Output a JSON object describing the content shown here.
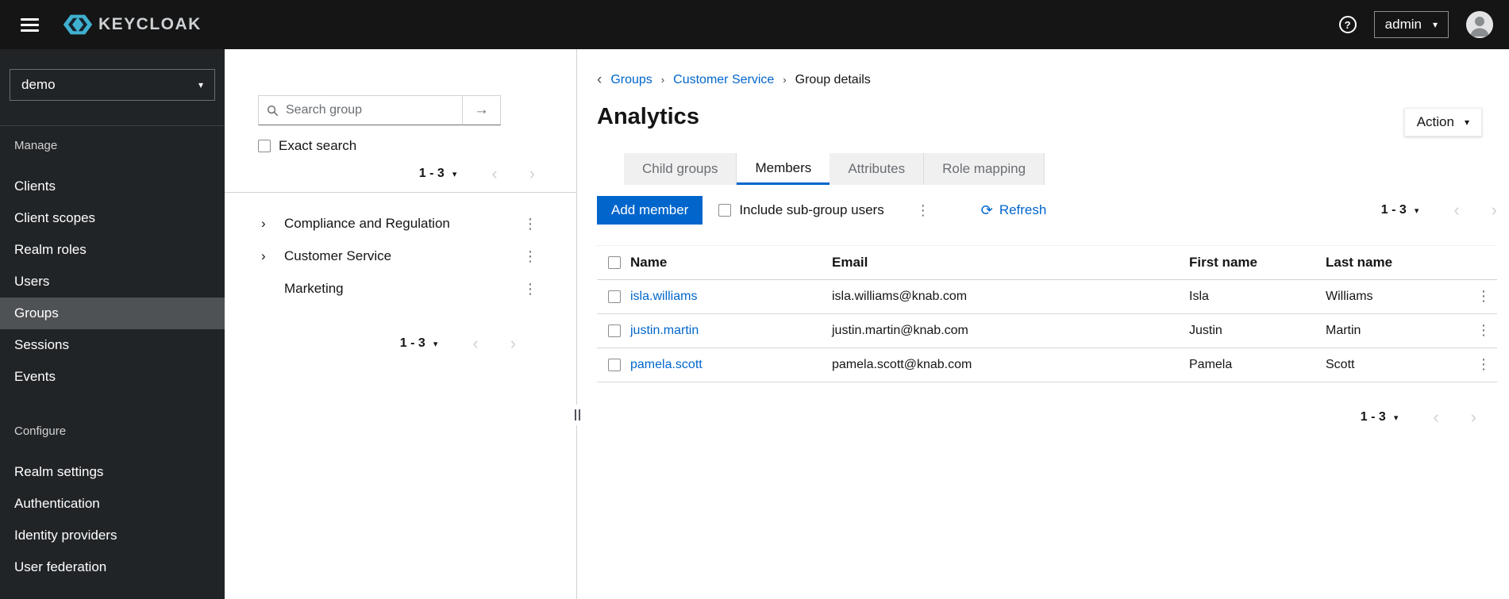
{
  "colors": {
    "accent": "#0066cc",
    "link": "#0066cc",
    "masthead_bg": "#151515",
    "sidebar_bg": "#212427",
    "nav_active_bg": "#4f5255",
    "tab_inactive_bg": "#f0f0f0"
  },
  "icons": {
    "hamburger": "menu-bars",
    "help": "?",
    "caret_down": "▾",
    "chevron_left": "‹",
    "chevron_right": "›",
    "tree_expand": "›",
    "kebab": "⋮",
    "search": "magnifier",
    "search_submit": "→",
    "refresh": "⟳",
    "breadcrumb_back": "‹",
    "breadcrumb_sep": "›"
  },
  "masthead": {
    "brand": "KEYCLOAK",
    "username": "admin"
  },
  "sidebar": {
    "realm": "demo",
    "active_item": "Groups",
    "manage": {
      "label": "Manage",
      "items": [
        "Clients",
        "Client scopes",
        "Realm roles",
        "Users",
        "Groups",
        "Sessions",
        "Events"
      ]
    },
    "configure": {
      "label": "Configure",
      "items": [
        "Realm settings",
        "Authentication",
        "Identity providers",
        "User federation"
      ]
    }
  },
  "tree": {
    "search_placeholder": "Search group",
    "exact_search_label": "Exact search",
    "pagination_top": "1 - 3",
    "pagination_bottom": "1 - 3",
    "items": [
      {
        "label": "Compliance and Regulation",
        "expandable": true
      },
      {
        "label": "Customer Service",
        "expandable": true
      },
      {
        "label": "Marketing",
        "expandable": false
      }
    ]
  },
  "main": {
    "breadcrumb": {
      "groups": "Groups",
      "parent": "Customer Service",
      "current": "Group details"
    },
    "title": "Analytics",
    "action_button": "Action",
    "tabs": [
      {
        "label": "Child groups",
        "active": false
      },
      {
        "label": "Members",
        "active": true
      },
      {
        "label": "Attributes",
        "active": false
      },
      {
        "label": "Role mapping",
        "active": false
      }
    ],
    "toolbar": {
      "add_member": "Add member",
      "include_subgroups": "Include sub-group users",
      "refresh": "Refresh",
      "pagination": "1 - 3"
    },
    "table": {
      "headers": {
        "name": "Name",
        "email": "Email",
        "first_name": "First name",
        "last_name": "Last name"
      },
      "rows": [
        {
          "name": "isla.williams",
          "email": "isla.williams@knab.com",
          "first_name": "Isla",
          "last_name": "Williams"
        },
        {
          "name": "justin.martin",
          "email": "justin.martin@knab.com",
          "first_name": "Justin",
          "last_name": "Martin"
        },
        {
          "name": "pamela.scott",
          "email": "pamela.scott@knab.com",
          "first_name": "Pamela",
          "last_name": "Scott"
        }
      ]
    },
    "pagination_bottom": "1 - 3"
  }
}
